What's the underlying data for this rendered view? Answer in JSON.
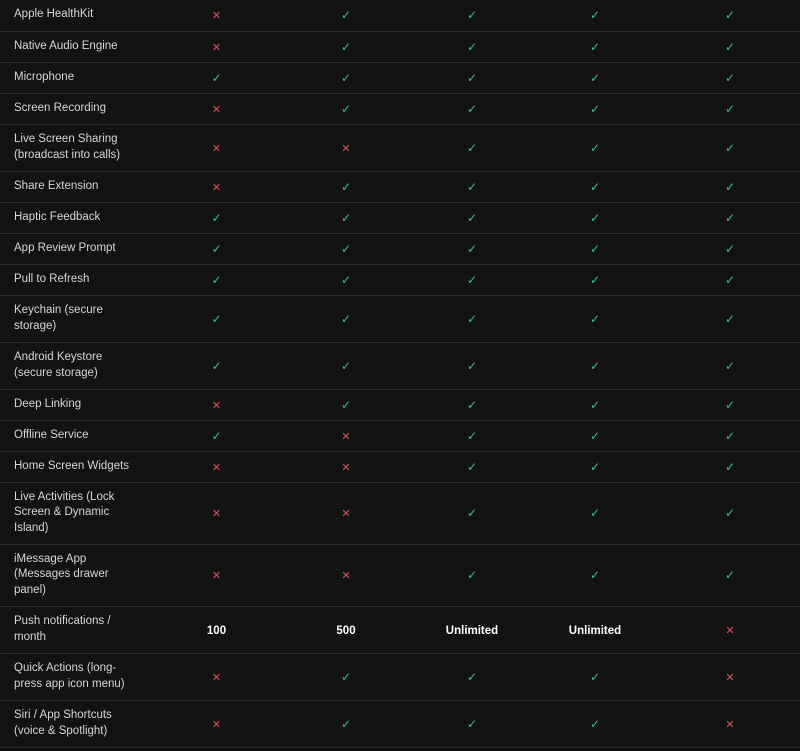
{
  "colors": {
    "background": "#121212",
    "yes": "#34c77b",
    "no": "#e0505b",
    "text": "#d6d6d6"
  },
  "icons": {
    "yes": "check-icon",
    "no": "cross-icon"
  },
  "rows": [
    {
      "feature": [
        "Apple HealthKit"
      ],
      "values": [
        "no",
        "yes",
        "yes",
        "yes",
        "yes"
      ]
    },
    {
      "feature": [
        "Native Audio Engine"
      ],
      "values": [
        "no",
        "yes",
        "yes",
        "yes",
        "yes"
      ]
    },
    {
      "feature": [
        "Microphone"
      ],
      "values": [
        "yes",
        "yes",
        "yes",
        "yes",
        "yes"
      ]
    },
    {
      "feature": [
        "Screen Recording"
      ],
      "values": [
        "no",
        "yes",
        "yes",
        "yes",
        "yes"
      ]
    },
    {
      "feature": [
        "Live Screen Sharing",
        "(broadcast into calls)"
      ],
      "values": [
        "no",
        "no",
        "yes",
        "yes",
        "yes"
      ]
    },
    {
      "feature": [
        "Share Extension"
      ],
      "values": [
        "no",
        "yes",
        "yes",
        "yes",
        "yes"
      ]
    },
    {
      "feature": [
        "Haptic Feedback"
      ],
      "values": [
        "yes",
        "yes",
        "yes",
        "yes",
        "yes"
      ]
    },
    {
      "feature": [
        "App Review Prompt"
      ],
      "values": [
        "yes",
        "yes",
        "yes",
        "yes",
        "yes"
      ]
    },
    {
      "feature": [
        "Pull to Refresh"
      ],
      "values": [
        "yes",
        "yes",
        "yes",
        "yes",
        "yes"
      ]
    },
    {
      "feature": [
        "Keychain (secure",
        "storage)"
      ],
      "values": [
        "yes",
        "yes",
        "yes",
        "yes",
        "yes"
      ]
    },
    {
      "feature": [
        "Android Keystore",
        "(secure storage)"
      ],
      "values": [
        "yes",
        "yes",
        "yes",
        "yes",
        "yes"
      ]
    },
    {
      "feature": [
        "Deep Linking"
      ],
      "values": [
        "no",
        "yes",
        "yes",
        "yes",
        "yes"
      ]
    },
    {
      "feature": [
        "Offline Service"
      ],
      "values": [
        "yes",
        "no",
        "yes",
        "yes",
        "yes"
      ]
    },
    {
      "feature": [
        "Home Screen Widgets"
      ],
      "values": [
        "no",
        "no",
        "yes",
        "yes",
        "yes"
      ]
    },
    {
      "feature": [
        "Live Activities (Lock",
        "Screen & Dynamic",
        "Island)"
      ],
      "values": [
        "no",
        "no",
        "yes",
        "yes",
        "yes"
      ]
    },
    {
      "feature": [
        "iMessage App",
        "(Messages drawer",
        "panel)"
      ],
      "values": [
        "no",
        "no",
        "yes",
        "yes",
        "yes"
      ]
    },
    {
      "feature": [
        "Push notifications /",
        "month"
      ],
      "values": [
        "100",
        "500",
        "Unlimited",
        "Unlimited",
        "no"
      ]
    },
    {
      "feature": [
        "Quick Actions (long-",
        "press app icon menu)"
      ],
      "values": [
        "no",
        "yes",
        "yes",
        "yes",
        "no"
      ]
    },
    {
      "feature": [
        "Siri / App Shortcuts",
        "(voice & Spotlight)"
      ],
      "values": [
        "no",
        "yes",
        "yes",
        "yes",
        "no"
      ]
    }
  ]
}
